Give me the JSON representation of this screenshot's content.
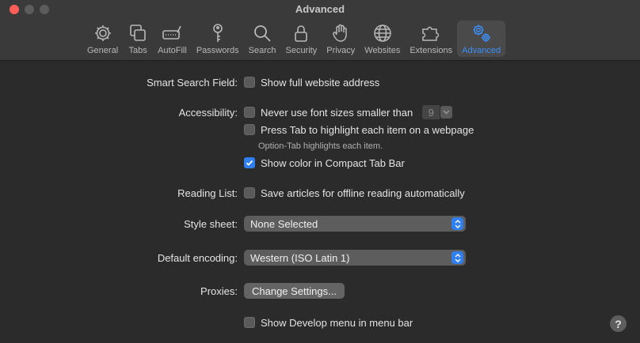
{
  "window": {
    "title": "Advanced"
  },
  "toolbar": {
    "tabs": [
      {
        "label": "General",
        "icon": "gear-icon"
      },
      {
        "label": "Tabs",
        "icon": "tabs-icon"
      },
      {
        "label": "AutoFill",
        "icon": "autofill-icon"
      },
      {
        "label": "Passwords",
        "icon": "key-icon"
      },
      {
        "label": "Search",
        "icon": "search-icon"
      },
      {
        "label": "Security",
        "icon": "lock-icon"
      },
      {
        "label": "Privacy",
        "icon": "hand-icon"
      },
      {
        "label": "Websites",
        "icon": "globe-icon"
      },
      {
        "label": "Extensions",
        "icon": "puzzle-icon"
      },
      {
        "label": "Advanced",
        "icon": "gears-icon",
        "active": true
      }
    ]
  },
  "settings": {
    "smart_search": {
      "label": "Smart Search Field:",
      "option": "Show full website address",
      "checked": false
    },
    "accessibility": {
      "label": "Accessibility:",
      "font_size_option": "Never use font sizes smaller than",
      "font_size_value": "9",
      "tab_option": "Press Tab to highlight each item on a webpage",
      "tab_hint": "Option-Tab highlights each item.",
      "compact_option": "Show color in Compact Tab Bar",
      "compact_checked": true
    },
    "reading_list": {
      "label": "Reading List:",
      "option": "Save articles for offline reading automatically"
    },
    "style_sheet": {
      "label": "Style sheet:",
      "value": "None Selected"
    },
    "encoding": {
      "label": "Default encoding:",
      "value": "Western (ISO Latin 1)"
    },
    "proxies": {
      "label": "Proxies:",
      "button": "Change Settings..."
    },
    "develop": {
      "option": "Show Develop menu in menu bar"
    }
  },
  "help": {
    "label": "?"
  },
  "colors": {
    "accent": "#2f7ff0",
    "active_tab_text": "#3d8ef7",
    "close": "#ff5f57"
  }
}
